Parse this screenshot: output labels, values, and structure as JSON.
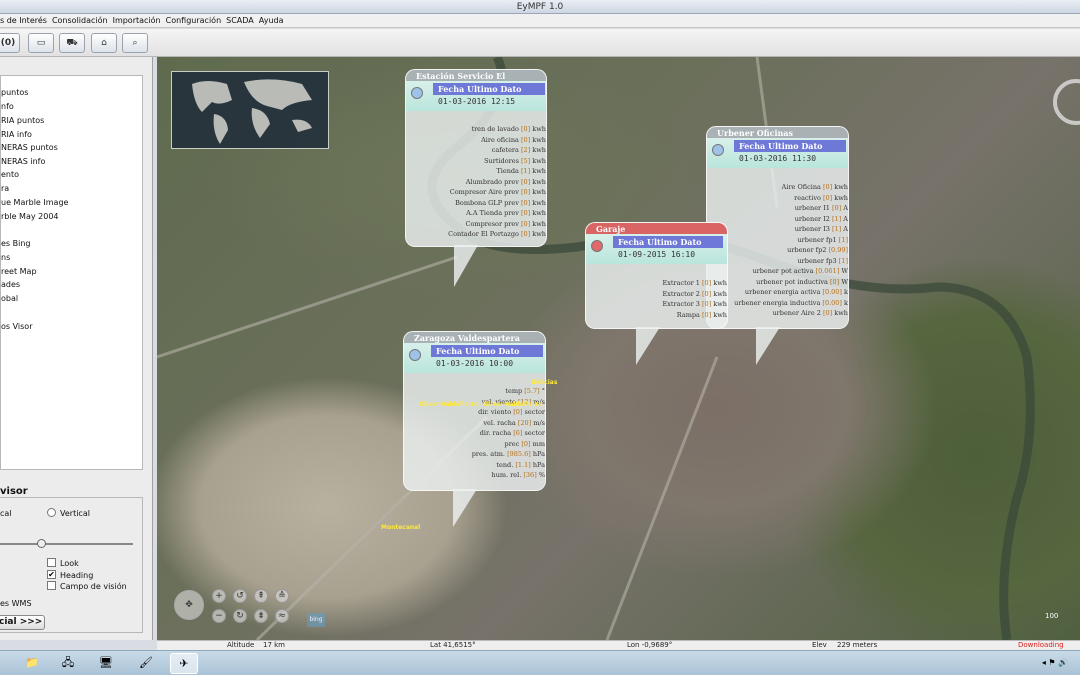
{
  "window": {
    "title": "EyMPF 1.0"
  },
  "menu": [
    "s de Interés",
    "Consolidación",
    "Importación",
    "Configuración",
    "SCADA",
    "Ayuda"
  ],
  "toolbar": {
    "count_label": "(0)"
  },
  "layers": [
    "puntos",
    "nfo",
    "RIA puntos",
    "RIA info",
    "NERAS puntos",
    "NERAS info",
    "ento",
    "ra",
    "ue Marble Image",
    "rble May 2004",
    "es Bing",
    "ns",
    "reet Map",
    "ades",
    "obal",
    "os Visor"
  ],
  "visor": {
    "title": "visor",
    "opt_left": "cal",
    "opt_vertical": "Vertical",
    "look": "Look",
    "heading": "Heading",
    "fov": "Campo de visión",
    "wms": "es WMS",
    "initial_button": "cial >>>"
  },
  "popups": {
    "portazgo": {
      "title": "Estación Servicio El Portazgo",
      "head": "Fecha Ultimo Dato",
      "date": "01-03-2016 12:15",
      "rows": [
        [
          "tren de lavado",
          "[0]",
          "kwh"
        ],
        [
          "Aire oficina",
          "[0]",
          "kwh"
        ],
        [
          "cafetera",
          "[2]",
          "kwh"
        ],
        [
          "Surtidores",
          "[5]",
          "kwh"
        ],
        [
          "Tienda",
          "[1]",
          "kwh"
        ],
        [
          "Alumbrado prev",
          "[0]",
          "kwh"
        ],
        [
          "Compresor Aire prev",
          "[0]",
          "kwh"
        ],
        [
          "Bombona GLP prev",
          "[0]",
          "kwh"
        ],
        [
          "A.A Tienda prev",
          "[0]",
          "kwh"
        ],
        [
          "Compresor prev",
          "[0]",
          "kwh"
        ],
        [
          "Contador El Portazgo",
          "[0]",
          "kwh"
        ]
      ]
    },
    "urbener": {
      "title": "Urbener Oficinas",
      "head": "Fecha Ultimo Dato",
      "date": "01-03-2016 11:30",
      "rows": [
        [
          "Aire Oficina",
          "[0]",
          "kwh"
        ],
        [
          "reactivo",
          "[0]",
          "kwh"
        ],
        [
          "urbener I1",
          "[0]",
          "A"
        ],
        [
          "urbener I2",
          "[1]",
          "A"
        ],
        [
          "urbener I3",
          "[1]",
          "A"
        ],
        [
          "urbener fp1",
          "[1]",
          ""
        ],
        [
          "urbener fp2",
          "[0.99]",
          ""
        ],
        [
          "urbener fp3",
          "[1]",
          ""
        ],
        [
          "urbener pot activa",
          "[0.061]",
          "W"
        ],
        [
          "urbener pot inductiva",
          "[0]",
          "W"
        ],
        [
          "urbener energia activa",
          "[0.00]",
          "k"
        ],
        [
          "urbener energia inductiva",
          "[0.00]",
          "k"
        ],
        [
          "urbener Aire 2",
          "[0]",
          "kwh"
        ]
      ]
    },
    "garaje": {
      "title": "Garaje",
      "head": "Fecha Ultimo Dato",
      "date": "01-09-2015 16:10",
      "rows": [
        [
          "Extractor 1",
          "[0]",
          "kwh"
        ],
        [
          "Extractor 2",
          "[0]",
          "kwh"
        ],
        [
          "Extractor 3",
          "[0]",
          "kwh"
        ],
        [
          "Rampa",
          "[0]",
          "kwh"
        ]
      ]
    },
    "valdespartera": {
      "title": "Zaragoza Valdespartera",
      "head": "Fecha Ultimo Dato",
      "date": "01-03-2016 10:00",
      "rows": [
        [
          "temp",
          "[5.7]",
          "°"
        ],
        [
          "vel. viento",
          "[12]",
          "m/s"
        ],
        [
          "dir. viento",
          "[0]",
          "sector"
        ],
        [
          "vel. racha",
          "[20]",
          "m/s"
        ],
        [
          "dir. racha",
          "[6]",
          "sector"
        ],
        [
          "prec",
          "[0]",
          "mm"
        ],
        [
          "pres. atm.",
          "[985.6]",
          "hPa"
        ],
        [
          "tend.",
          "[1.1]",
          "hPa"
        ],
        [
          "hum. rel.",
          "[36]",
          "%"
        ]
      ]
    }
  },
  "map_labels": {
    "delicias": "Delicias",
    "oliver": "Oliver-Valdefierro, Oliver-Valdefierro",
    "montecanal": "Montecanal"
  },
  "map_extra": {
    "bing": "bing",
    "scale": "100"
  },
  "status": {
    "altitude_label": "Altitude",
    "altitude_value": "17 km",
    "lat": "Lat 41,6515°",
    "lon": "Lon -0,9689°",
    "elev_label": "Elev",
    "elev_value": "229 meters",
    "downloading": "Downloading"
  },
  "colors": {
    "accent": "#6e78d6",
    "status_red": "#d86464",
    "downloading": "#e02020"
  }
}
